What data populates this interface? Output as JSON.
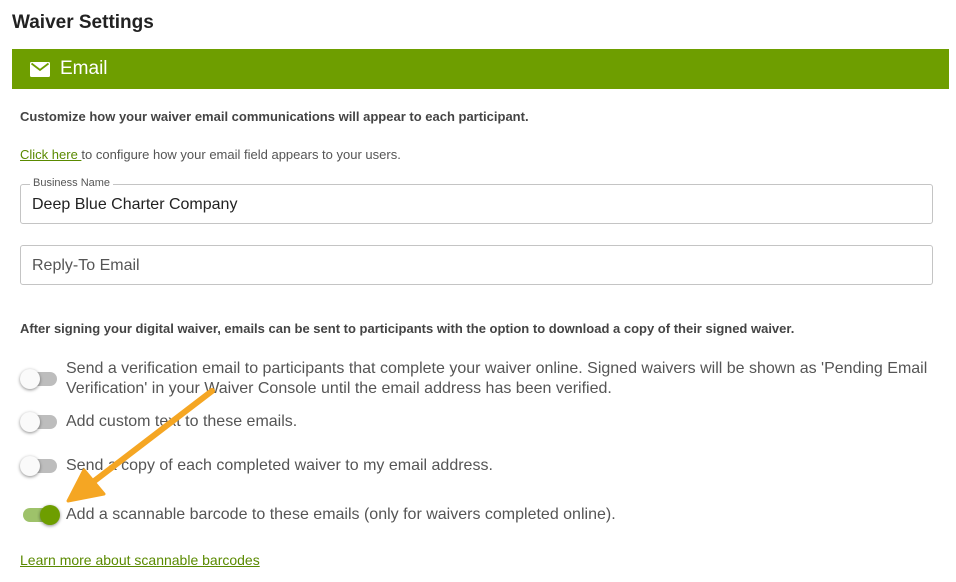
{
  "page_title": "Waiver Settings",
  "section": {
    "title": "Email",
    "icon": "envelope-icon"
  },
  "intro_text": "Customize how your waiver email communications will appear to each participant.",
  "config_link": {
    "link_text": "Click here ",
    "rest_text": "to configure how your email field appears to your users."
  },
  "business_name": {
    "label": "Business Name",
    "value": "Deep Blue Charter Company"
  },
  "reply_to": {
    "placeholder": "Reply-To Email"
  },
  "after_signing_text": "After signing your digital waiver, emails can be sent to participants with the option to download a copy of their signed waiver.",
  "options": [
    {
      "label": "Send a verification email to participants that complete your waiver online. Signed waivers will be shown as 'Pending Email Verification' in your Waiver Console until the email address has been verified.",
      "enabled": false
    },
    {
      "label": "Add custom text to these emails.",
      "enabled": false
    },
    {
      "label": "Send a copy of each completed waiver to my email address.",
      "enabled": false
    },
    {
      "label": "Add a scannable barcode to these emails (only for waivers completed online).",
      "enabled": true
    }
  ],
  "learn_more": "Learn more about scannable barcodes",
  "colors": {
    "brand_green": "#6e9e00",
    "arrow": "#f5a623"
  }
}
